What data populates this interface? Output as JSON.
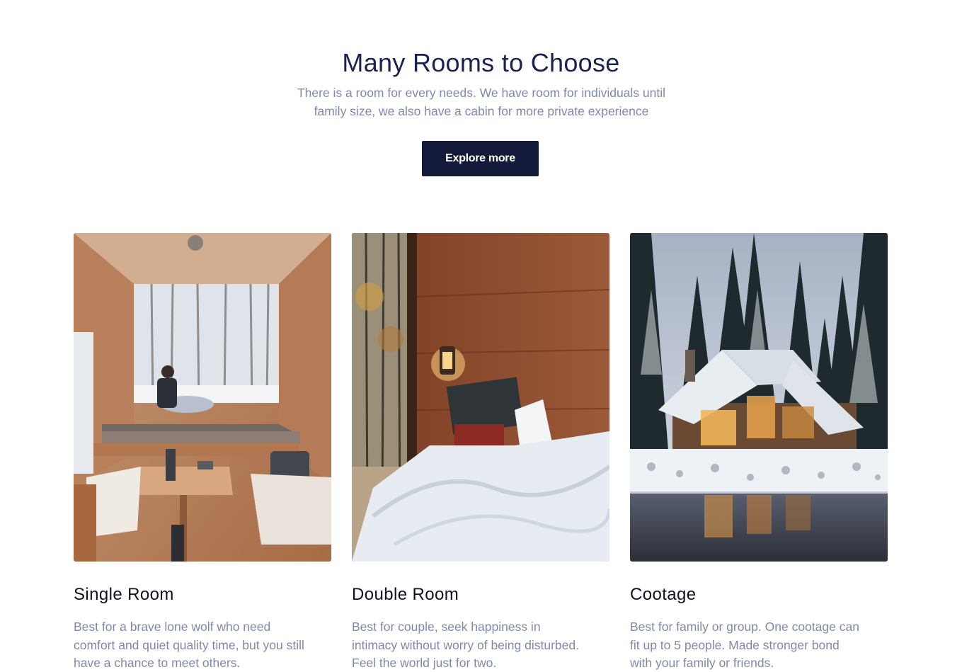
{
  "hero": {
    "title": "Many Rooms to Choose",
    "subtitle_lines": [
      "There is a room for every needs. We have room for individuals until",
      "family size, we also have a cabin for more private experience"
    ],
    "button_label": "Explore more"
  },
  "rooms": [
    {
      "title": "Single Room",
      "description_lines": [
        "Best for a brave lone wolf who need",
        "comfort and quiet quality time, but you still",
        "have a chance to meet others."
      ]
    },
    {
      "title": "Double Room",
      "description_lines": [
        "Best for couple, seek happiness in",
        "intimacy without worry of being disturbed.",
        "Feel the world just for two."
      ]
    },
    {
      "title": "Cootage",
      "description_lines": [
        "Best for family or group. One cootage can",
        "fit up to 5 people. Made stronger bond",
        "with your family or friends."
      ]
    }
  ],
  "colors": {
    "heading": "#1b2250",
    "muted_text": "#8089a8",
    "button_bg": "#141a3a",
    "card_title": "#111322"
  }
}
